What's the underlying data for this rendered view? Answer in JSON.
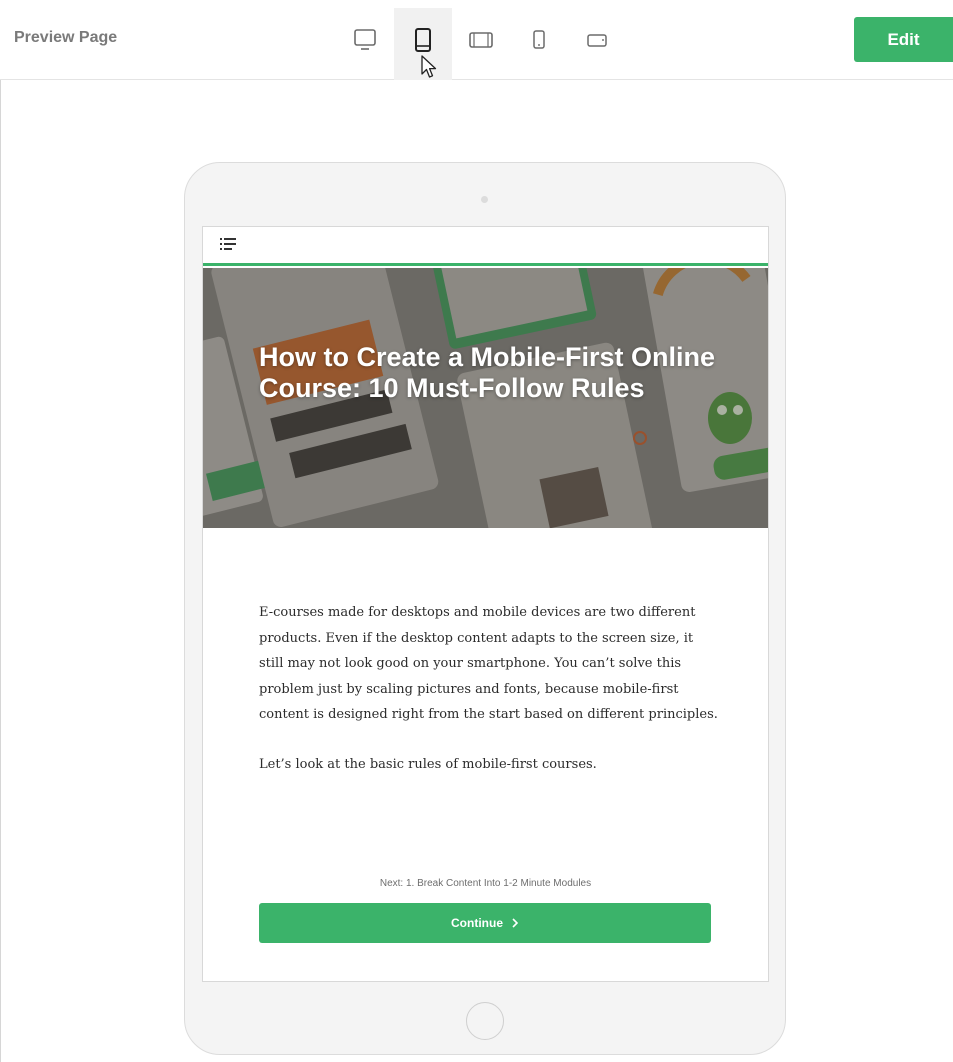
{
  "toolbar": {
    "title": "Preview Page",
    "edit_label": "Edit",
    "devices": [
      {
        "name": "desktop",
        "icon": "monitor-icon",
        "active": false
      },
      {
        "name": "tablet-portrait",
        "icon": "tablet-portrait-icon",
        "active": true
      },
      {
        "name": "tablet-landscape",
        "icon": "tablet-landscape-icon",
        "active": false
      },
      {
        "name": "phone-portrait",
        "icon": "phone-portrait-icon",
        "active": false
      },
      {
        "name": "phone-landscape",
        "icon": "phone-landscape-icon",
        "active": false
      }
    ]
  },
  "page": {
    "title": "How to Create a Mobile-First Online Course: 10 Must-Follow Rules",
    "paragraphs": [
      "E-courses made for desktops and mobile devices are two different products. Even if the desktop content adapts to the screen size, it still may not look good on your smartphone. You can’t solve this problem just by scaling pictures and fonts, because mobile-first content is designed right from the start based on different principles.",
      "Let’s look at the basic rules of mobile-first courses."
    ],
    "next_label": "Next: 1. Break Content Into 1-2 Minute Modules",
    "continue_label": "Continue",
    "continue_icon": "chevron-right-icon",
    "menu_icon": "list-menu-icon"
  },
  "colors": {
    "accent": "#3bb36a",
    "toolbar_title": "#7a7a7a"
  }
}
